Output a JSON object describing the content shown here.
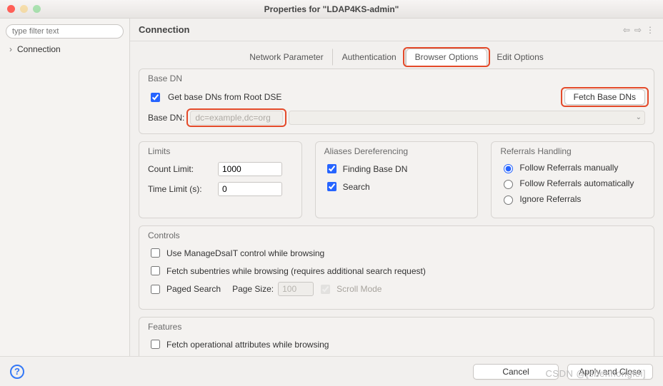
{
  "window": {
    "title": "Properties for \"LDAP4KS-admin\""
  },
  "sidebar": {
    "filter_placeholder": "type filter text",
    "items": [
      {
        "label": "Connection"
      }
    ]
  },
  "header": {
    "title": "Connection"
  },
  "tabs": [
    {
      "label": "Network Parameter",
      "active": false
    },
    {
      "label": "Authentication",
      "active": false
    },
    {
      "label": "Browser Options",
      "active": true
    },
    {
      "label": "Edit Options",
      "active": false
    }
  ],
  "baseDnGroup": {
    "title": "Base DN",
    "getFromRoot": {
      "label": "Get base DNs from Root DSE",
      "checked": true
    },
    "fetchBtn": "Fetch Base DNs",
    "baseDnLabel": "Base DN:",
    "baseDnValue": "dc=example,dc=org"
  },
  "limits": {
    "title": "Limits",
    "countLabel": "Count Limit:",
    "countValue": "1000",
    "timeLabel": "Time Limit (s):",
    "timeValue": "0"
  },
  "aliases": {
    "title": "Aliases Dereferencing",
    "findingBase": {
      "label": "Finding Base DN",
      "checked": true
    },
    "search": {
      "label": "Search",
      "checked": true
    }
  },
  "referrals": {
    "title": "Referrals Handling",
    "options": [
      {
        "label": "Follow Referrals manually",
        "selected": true
      },
      {
        "label": "Follow Referrals automatically",
        "selected": false
      },
      {
        "label": "Ignore Referrals",
        "selected": false
      }
    ]
  },
  "controls": {
    "title": "Controls",
    "manageDsa": {
      "label": "Use ManageDsaIT control while browsing",
      "checked": false
    },
    "subentries": {
      "label": "Fetch subentries while browsing (requires additional search request)",
      "checked": false
    },
    "paged": {
      "label": "Paged Search",
      "checked": false
    },
    "pageSizeLabel": "Page Size:",
    "pageSizeValue": "100",
    "scrollMode": {
      "label": "Scroll Mode",
      "checked": true
    }
  },
  "features": {
    "title": "Features",
    "fetchOp": {
      "label": "Fetch operational attributes while browsing",
      "checked": false
    }
  },
  "footer": {
    "cancel": "Cancel",
    "apply": "Apply and Close"
  },
  "watermark": "CSDN @[shenhonglei]"
}
